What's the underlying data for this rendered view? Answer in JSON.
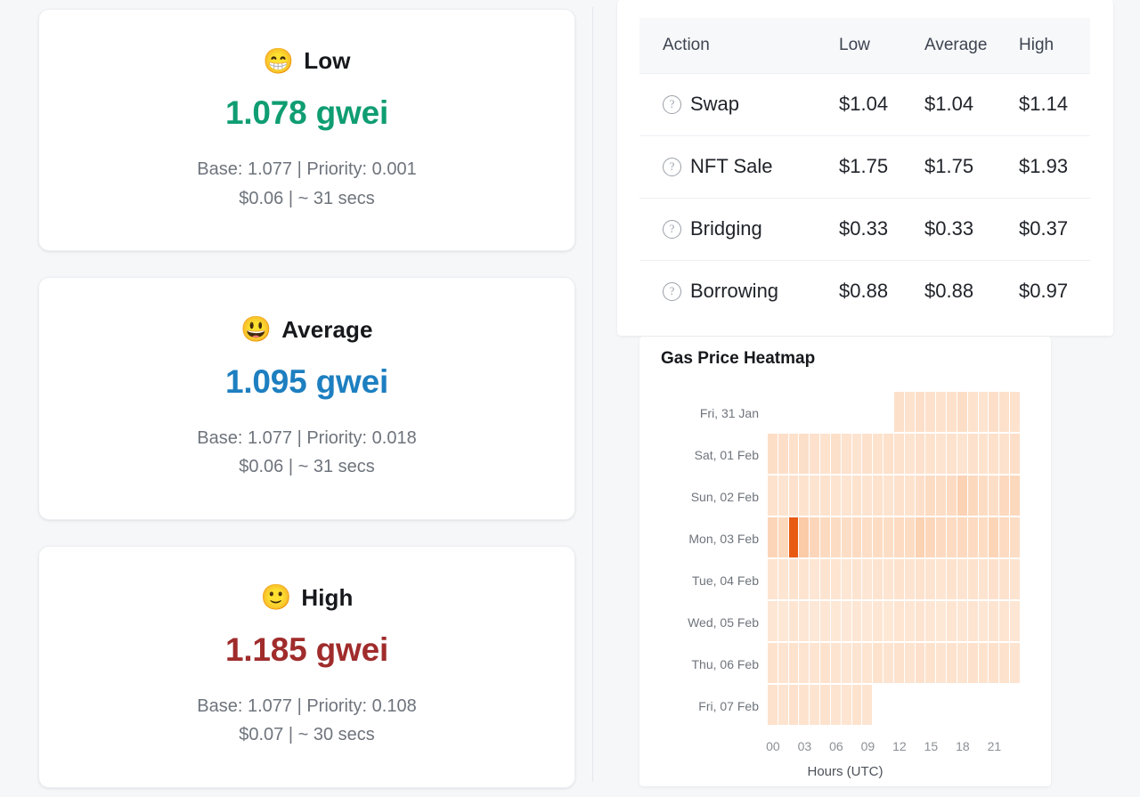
{
  "colors": {
    "low": "#0f9d72",
    "average": "#1d7fc0",
    "high": "#a02c2c",
    "page_bg": "#f6f7f9",
    "card_bg": "#ffffff",
    "table_header_bg": "#f7f8fa",
    "heatmap_max": "#e8580f"
  },
  "gas_cards": [
    {
      "emoji": "😁",
      "emoji_name": "grinning-face-with-smiling-eyes",
      "label": "Low",
      "value": "1.078 gwei",
      "detail": "Base: 1.077 | Priority: 0.001",
      "cost": "$0.06 | ~ 31 secs",
      "color_key": "low"
    },
    {
      "emoji": "😃",
      "emoji_name": "grinning-face-with-big-eyes",
      "label": "Average",
      "value": "1.095 gwei",
      "detail": "Base: 1.077 | Priority: 0.018",
      "cost": "$0.06 | ~ 31 secs",
      "color_key": "average"
    },
    {
      "emoji": "🙂",
      "emoji_name": "slightly-smiling-face",
      "label": "High",
      "value": "1.185 gwei",
      "detail": "Base: 1.077 | Priority: 0.108",
      "cost": "$0.07 | ~ 30 secs",
      "color_key": "high"
    }
  ],
  "action_table": {
    "columns": [
      "Action",
      "Low",
      "Average",
      "High"
    ],
    "info_icon": "question-mark-circle",
    "rows": [
      {
        "action": "Swap",
        "low": "$1.04",
        "average": "$1.04",
        "high": "$1.14"
      },
      {
        "action": "NFT Sale",
        "low": "$1.75",
        "average": "$1.75",
        "high": "$1.93"
      },
      {
        "action": "Bridging",
        "low": "$0.33",
        "average": "$0.33",
        "high": "$0.37"
      },
      {
        "action": "Borrowing",
        "low": "$0.88",
        "average": "$0.88",
        "high": "$0.97"
      }
    ]
  },
  "heatmap": {
    "title": "Gas Price Heatmap"
  },
  "chart_data": {
    "type": "heatmap",
    "title": "Gas Price Heatmap",
    "xlabel": "Hours (UTC)",
    "ylabel": "",
    "x_ticks": [
      "00",
      "03",
      "06",
      "09",
      "12",
      "15",
      "18",
      "21"
    ],
    "x_tick_hours": [
      0,
      3,
      6,
      9,
      12,
      15,
      18,
      21
    ],
    "x_range": [
      0,
      24
    ],
    "grid": false,
    "legend": "none",
    "colorscale": [
      "#fdf4ec",
      "#fde5d2",
      "#fbcdab",
      "#f6a878",
      "#e8580f"
    ],
    "value_unit": "gwei",
    "vmin": 0.9,
    "vmax": 7.5,
    "rows": [
      {
        "day": "Fri, 31 Jan",
        "start_hour": 12,
        "values": [
          1.28,
          1.22,
          1.3,
          1.24,
          1.2,
          1.26,
          1.34,
          1.22,
          1.18,
          1.3,
          1.26,
          1.22
        ]
      },
      {
        "day": "Sat, 01 Feb",
        "start_hour": 0,
        "values": [
          1.34,
          1.3,
          1.26,
          1.32,
          1.24,
          1.2,
          1.28,
          1.22,
          1.18,
          1.24,
          1.2,
          1.26,
          1.22,
          1.18,
          1.24,
          1.2,
          1.16,
          1.22,
          1.18,
          1.24,
          1.2,
          1.26,
          1.22,
          1.3
        ]
      },
      {
        "day": "Sun, 02 Feb",
        "start_hour": 0,
        "values": [
          1.22,
          1.18,
          1.24,
          1.2,
          1.16,
          1.22,
          1.18,
          1.14,
          1.2,
          1.16,
          1.22,
          1.18,
          1.24,
          1.2,
          1.3,
          1.42,
          1.38,
          1.46,
          1.86,
          1.58,
          1.4,
          1.34,
          1.52,
          1.6
        ]
      },
      {
        "day": "Mon, 03 Feb",
        "start_hour": 0,
        "values": [
          1.72,
          1.6,
          7.4,
          2.3,
          1.66,
          1.5,
          1.42,
          1.38,
          1.44,
          1.34,
          1.4,
          1.36,
          1.46,
          1.42,
          1.9,
          1.62,
          1.48,
          1.44,
          1.52,
          1.46,
          1.4,
          1.74,
          1.44,
          1.38
        ]
      },
      {
        "day": "Tue, 04 Feb",
        "start_hour": 0,
        "values": [
          1.18,
          1.14,
          1.2,
          1.16,
          1.12,
          1.18,
          1.14,
          1.1,
          1.16,
          1.12,
          1.18,
          1.14,
          1.2,
          1.16,
          1.22,
          1.18,
          1.14,
          1.2,
          1.16,
          1.22,
          1.18,
          1.24,
          1.2,
          1.16
        ]
      },
      {
        "day": "Wed, 05 Feb",
        "start_hour": 0,
        "values": [
          1.12,
          1.08,
          1.14,
          1.1,
          1.06,
          1.12,
          1.08,
          1.04,
          1.1,
          1.06,
          1.12,
          1.08,
          1.14,
          1.1,
          1.16,
          1.12,
          1.08,
          1.14,
          1.1,
          1.16,
          1.12,
          1.18,
          1.14,
          1.1
        ]
      },
      {
        "day": "Thu, 06 Feb",
        "start_hour": 0,
        "values": [
          1.2,
          1.16,
          1.22,
          1.18,
          1.14,
          1.2,
          1.16,
          1.12,
          1.18,
          1.14,
          1.2,
          1.16,
          1.22,
          1.18,
          1.24,
          1.2,
          1.16,
          1.22,
          1.18,
          1.24,
          1.2,
          1.26,
          1.22,
          1.18
        ]
      },
      {
        "day": "Fri, 07 Feb",
        "start_hour": 0,
        "end_hour": 10,
        "values": [
          1.22,
          1.18,
          1.24,
          1.2,
          1.16,
          1.22,
          1.18,
          1.14,
          1.2,
          1.16
        ]
      }
    ]
  }
}
